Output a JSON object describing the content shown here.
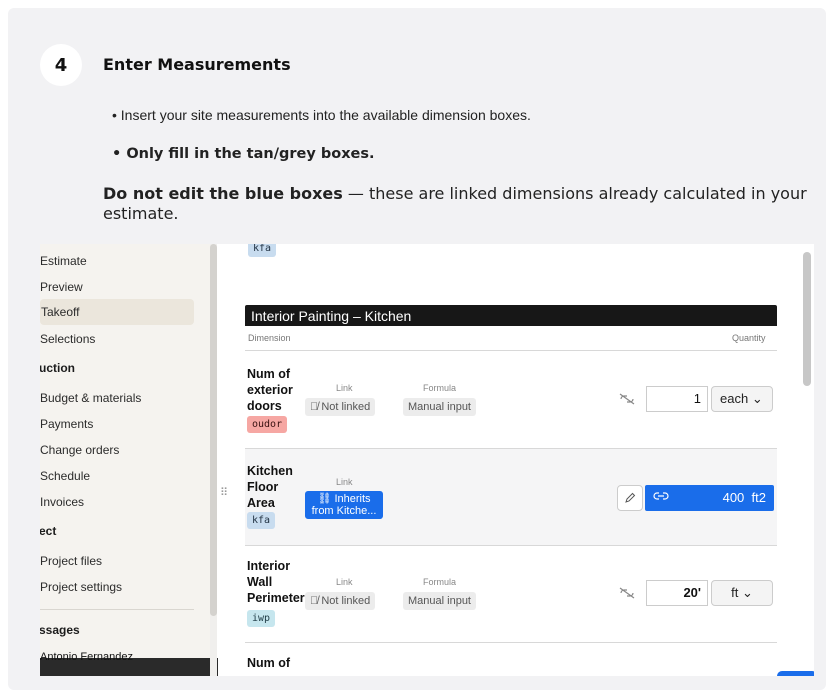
{
  "step": {
    "number": "4",
    "title": "Enter Measurements",
    "bullet1": "• Insert your site measurements into the available dimension boxes.",
    "bullet2": "• Only fill in the tan/grey boxes.",
    "note_bold": "Do not edit the blue boxes",
    "note_rest": " — these are linked dimensions already calculated in your estimate."
  },
  "sidebar": {
    "items": [
      {
        "label": "Estimate"
      },
      {
        "label": "Preview"
      },
      {
        "label": "Takeoff"
      },
      {
        "label": "Selections"
      },
      {
        "label": "uction"
      },
      {
        "label": "Budget & materials"
      },
      {
        "label": "Payments"
      },
      {
        "label": "Change orders"
      },
      {
        "label": "Schedule"
      },
      {
        "label": "Invoices"
      },
      {
        "label": "ect"
      },
      {
        "label": "Project files"
      },
      {
        "label": "Project settings"
      },
      {
        "label": "ssages"
      },
      {
        "label": "Antonio Fernandez"
      }
    ]
  },
  "top_tag": "kfa",
  "section": {
    "title": "Interior Painting – Kitchen",
    "col_dimension": "Dimension",
    "col_quantity": "Quantity"
  },
  "rows": [
    {
      "name": "Num of exterior doors",
      "name_lines": [
        "Num of",
        "exterior",
        "doors"
      ],
      "tag": "oudor",
      "link_label": "Link",
      "link_value": "Not linked",
      "formula_label": "Formula",
      "formula_value": "Manual input",
      "quantity": "1",
      "unit": "each"
    },
    {
      "name_lines": [
        "Kitchen",
        "Floor",
        "Area"
      ],
      "tag": "kfa",
      "link_label": "Link",
      "link_value_lines": [
        "Inherits",
        "from Kitche..."
      ],
      "quantity": "400",
      "unit": "ft2"
    },
    {
      "name_lines": [
        "Interior",
        "Wall",
        "Perimeter"
      ],
      "tag": "iwp",
      "link_label": "Link",
      "link_value": "Not linked",
      "formula_label": "Formula",
      "formula_value": "Manual input",
      "quantity": "20'",
      "unit": "ft"
    },
    {
      "name_lines": [
        "Num of"
      ]
    }
  ],
  "colors": {
    "accent_blue": "#1a6dea",
    "tag_red": "#f6a7a3",
    "tag_blue": "#c8dcef",
    "tag_cyan": "#c6e6ee"
  }
}
